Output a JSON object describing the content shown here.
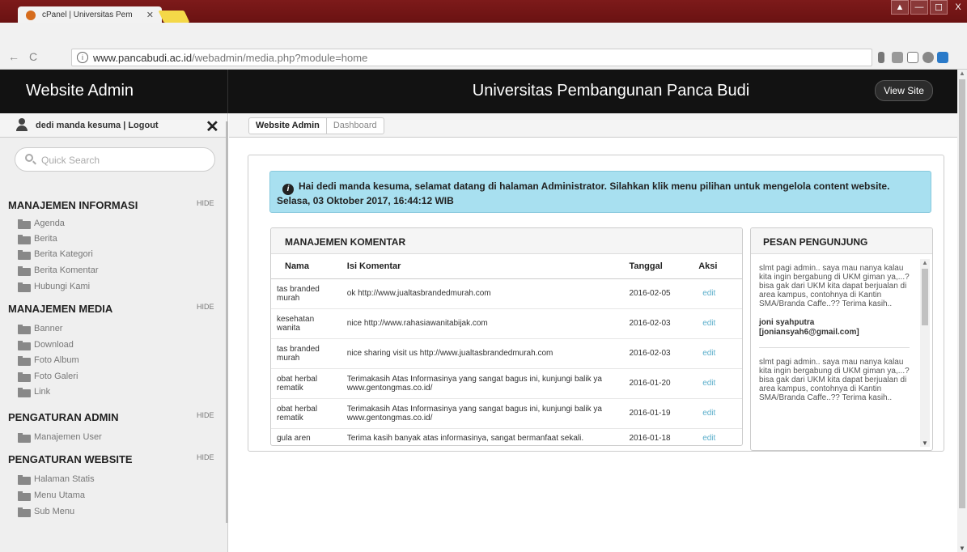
{
  "browser": {
    "tab_title": "cPanel | Universitas Pem",
    "url_host": "www.pancabudi.ac.id",
    "url_path": "/webadmin/media.php?module=home"
  },
  "header": {
    "brand": "Website Admin",
    "title": "Universitas Pembangunan Panca Budi",
    "view_site": "View Site"
  },
  "sidebar": {
    "user": "dedi manda kesuma | Logout",
    "search_placeholder": "Quick Search",
    "hide_label": "HIDE",
    "sections": [
      {
        "title": "MANAJEMEN INFORMASI",
        "items": [
          "Agenda",
          "Berita",
          "Berita Kategori",
          "Berita Komentar",
          "Hubungi Kami"
        ]
      },
      {
        "title": "MANAJEMEN MEDIA",
        "items": [
          "Banner",
          "Download",
          "Foto Album",
          "Foto Galeri",
          "Link"
        ]
      },
      {
        "title": "PENGATURAN ADMIN",
        "items": [
          "Manajemen User"
        ]
      },
      {
        "title": "PENGATURAN WEBSITE",
        "items": [
          "Halaman Statis",
          "Menu Utama",
          "Sub Menu"
        ]
      }
    ]
  },
  "breadcrumb": [
    "Website Admin",
    "Dashboard"
  ],
  "alert": {
    "line1": "Hai dedi manda kesuma, selamat datang di halaman Administrator. Silahkan klik menu pilihan untuk mengelola content website.",
    "line2": "Selasa, 03 Oktober 2017, 16:44:12 WIB"
  },
  "komentar": {
    "title": "MANAJEMEN KOMENTAR",
    "columns": [
      "Nama",
      "Isi Komentar",
      "Tanggal",
      "Aksi"
    ],
    "rows": [
      {
        "nama": "tas branded murah",
        "isi": "ok http://www.jualtasbrandedmurah.com",
        "tanggal": "2016-02-05",
        "aksi": "edit"
      },
      {
        "nama": "kesehatan wanita",
        "isi": "nice http://www.rahasiawanitabijak.com",
        "tanggal": "2016-02-03",
        "aksi": "edit"
      },
      {
        "nama": "tas branded murah",
        "isi": "nice sharing visit us http://www.jualtasbrandedmurah.com",
        "tanggal": "2016-02-03",
        "aksi": "edit"
      },
      {
        "nama": "obat herbal rematik",
        "isi": "Terimakasih Atas Informasinya yang sangat bagus ini, kunjungi balik ya www.gentongmas.co.id/",
        "tanggal": "2016-01-20",
        "aksi": "edit"
      },
      {
        "nama": "obat herbal rematik",
        "isi": "Terimakasih Atas Informasinya yang sangat bagus ini, kunjungi balik ya www.gentongmas.co.id/",
        "tanggal": "2016-01-19",
        "aksi": "edit"
      },
      {
        "nama": "gula aren",
        "isi": "Terima kasih banyak atas informasinya, sangat bermanfaat sekali.",
        "tanggal": "2016-01-18",
        "aksi": "edit"
      }
    ]
  },
  "pesan": {
    "title": "PESAN PENGUNJUNG",
    "messages": [
      {
        "text": "slmt pagi admin.. saya mau nanya kalau kita ingin bergabung di UKM giman ya,...? bisa gak dari UKM kita dapat berjualan di area kampus, contohnya di Kantin SMA/Branda Caffe..?? Terima kasih..",
        "sender": "joni syahputra [joniansyah6@gmail.com]"
      },
      {
        "text": "slmt pagi admin.. saya mau nanya kalau kita ingin bergabung di UKM giman ya,...? bisa gak dari UKM kita dapat berjualan di area kampus, contohnya di Kantin SMA/Branda Caffe..?? Terima kasih..",
        "sender": ""
      }
    ]
  }
}
